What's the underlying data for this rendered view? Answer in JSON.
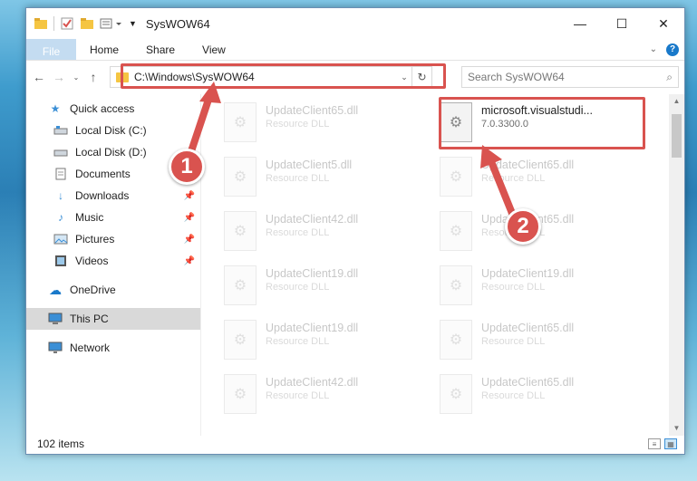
{
  "window": {
    "title": "SysWOW64",
    "controls": {
      "minimize": "—",
      "maximize": "☐",
      "close": "✕"
    }
  },
  "ribbon": {
    "file": "File",
    "tabs": [
      "Home",
      "Share",
      "View"
    ],
    "help": "?"
  },
  "addressbar": {
    "path": "C:\\Windows\\SysWOW64",
    "search_placeholder": "Search SysWOW64"
  },
  "navpane": {
    "quick_access": "Quick access",
    "items": [
      "Local Disk (C:)",
      "Local Disk (D:)",
      "Documents",
      "Downloads",
      "Music",
      "Pictures",
      "Videos"
    ],
    "onedrive": "OneDrive",
    "thispc": "This PC",
    "network": "Network"
  },
  "files": [
    {
      "name": "UpdateClient65.dll",
      "desc": "Resource DLL"
    },
    {
      "name": "microsoft.visualstudi...",
      "desc": "7.0.3300.0"
    },
    {
      "name": "UpdateClient5.dll",
      "desc": "Resource DLL"
    },
    {
      "name": "UpdateClient65.dll",
      "desc": "Resource DLL"
    },
    {
      "name": "UpdateClient42.dll",
      "desc": "Resource DLL"
    },
    {
      "name": "UpdateClient65.dll",
      "desc": "Resource DLL"
    },
    {
      "name": "UpdateClient19.dll",
      "desc": "Resource DLL"
    },
    {
      "name": "UpdateClient19.dll",
      "desc": "Resource DLL"
    },
    {
      "name": "UpdateClient19.dll",
      "desc": "Resource DLL"
    },
    {
      "name": "UpdateClient65.dll",
      "desc": "Resource DLL"
    },
    {
      "name": "UpdateClient42.dll",
      "desc": "Resource DLL"
    },
    {
      "name": "UpdateClient65.dll",
      "desc": "Resource DLL"
    }
  ],
  "status": {
    "count": "102 items"
  },
  "annotations": {
    "step1": "1",
    "step2": "2",
    "color": "#d9534f"
  }
}
